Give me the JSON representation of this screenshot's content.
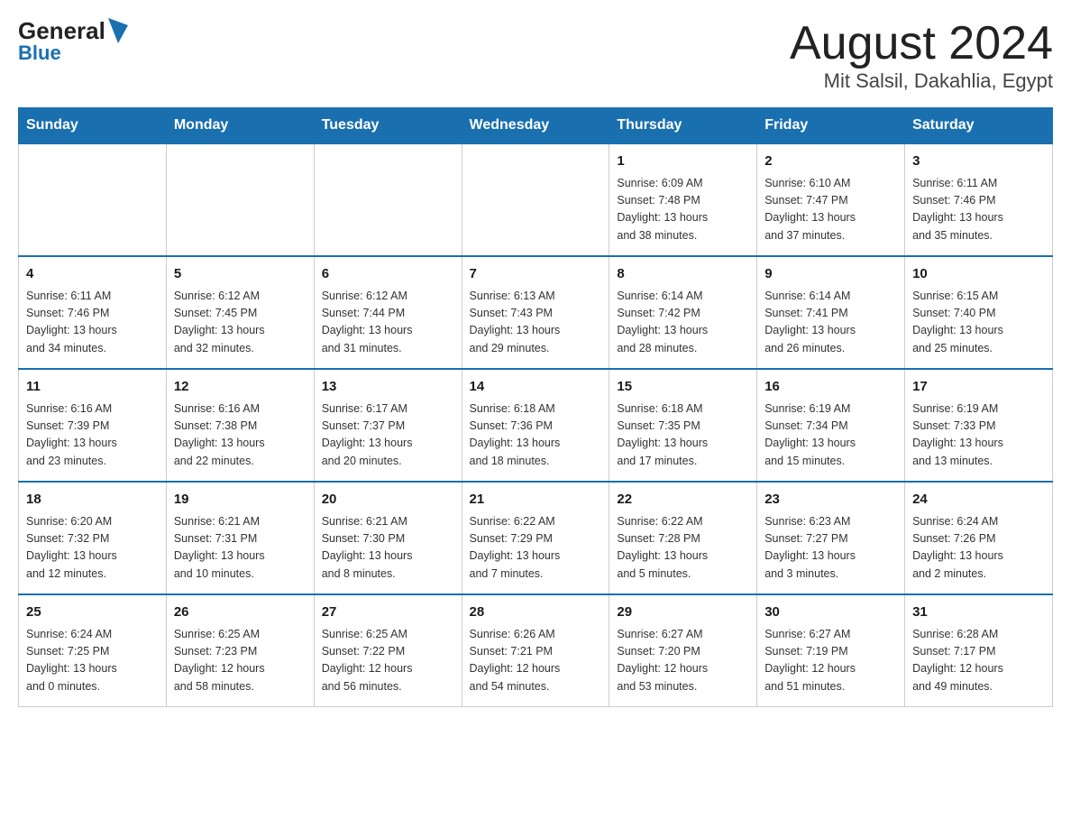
{
  "header": {
    "logo_general": "General",
    "logo_blue": "Blue",
    "title": "August 2024",
    "subtitle": "Mit Salsil, Dakahlia, Egypt"
  },
  "weekdays": [
    "Sunday",
    "Monday",
    "Tuesday",
    "Wednesday",
    "Thursday",
    "Friday",
    "Saturday"
  ],
  "weeks": [
    [
      {
        "day": "",
        "info": ""
      },
      {
        "day": "",
        "info": ""
      },
      {
        "day": "",
        "info": ""
      },
      {
        "day": "",
        "info": ""
      },
      {
        "day": "1",
        "info": "Sunrise: 6:09 AM\nSunset: 7:48 PM\nDaylight: 13 hours\nand 38 minutes."
      },
      {
        "day": "2",
        "info": "Sunrise: 6:10 AM\nSunset: 7:47 PM\nDaylight: 13 hours\nand 37 minutes."
      },
      {
        "day": "3",
        "info": "Sunrise: 6:11 AM\nSunset: 7:46 PM\nDaylight: 13 hours\nand 35 minutes."
      }
    ],
    [
      {
        "day": "4",
        "info": "Sunrise: 6:11 AM\nSunset: 7:46 PM\nDaylight: 13 hours\nand 34 minutes."
      },
      {
        "day": "5",
        "info": "Sunrise: 6:12 AM\nSunset: 7:45 PM\nDaylight: 13 hours\nand 32 minutes."
      },
      {
        "day": "6",
        "info": "Sunrise: 6:12 AM\nSunset: 7:44 PM\nDaylight: 13 hours\nand 31 minutes."
      },
      {
        "day": "7",
        "info": "Sunrise: 6:13 AM\nSunset: 7:43 PM\nDaylight: 13 hours\nand 29 minutes."
      },
      {
        "day": "8",
        "info": "Sunrise: 6:14 AM\nSunset: 7:42 PM\nDaylight: 13 hours\nand 28 minutes."
      },
      {
        "day": "9",
        "info": "Sunrise: 6:14 AM\nSunset: 7:41 PM\nDaylight: 13 hours\nand 26 minutes."
      },
      {
        "day": "10",
        "info": "Sunrise: 6:15 AM\nSunset: 7:40 PM\nDaylight: 13 hours\nand 25 minutes."
      }
    ],
    [
      {
        "day": "11",
        "info": "Sunrise: 6:16 AM\nSunset: 7:39 PM\nDaylight: 13 hours\nand 23 minutes."
      },
      {
        "day": "12",
        "info": "Sunrise: 6:16 AM\nSunset: 7:38 PM\nDaylight: 13 hours\nand 22 minutes."
      },
      {
        "day": "13",
        "info": "Sunrise: 6:17 AM\nSunset: 7:37 PM\nDaylight: 13 hours\nand 20 minutes."
      },
      {
        "day": "14",
        "info": "Sunrise: 6:18 AM\nSunset: 7:36 PM\nDaylight: 13 hours\nand 18 minutes."
      },
      {
        "day": "15",
        "info": "Sunrise: 6:18 AM\nSunset: 7:35 PM\nDaylight: 13 hours\nand 17 minutes."
      },
      {
        "day": "16",
        "info": "Sunrise: 6:19 AM\nSunset: 7:34 PM\nDaylight: 13 hours\nand 15 minutes."
      },
      {
        "day": "17",
        "info": "Sunrise: 6:19 AM\nSunset: 7:33 PM\nDaylight: 13 hours\nand 13 minutes."
      }
    ],
    [
      {
        "day": "18",
        "info": "Sunrise: 6:20 AM\nSunset: 7:32 PM\nDaylight: 13 hours\nand 12 minutes."
      },
      {
        "day": "19",
        "info": "Sunrise: 6:21 AM\nSunset: 7:31 PM\nDaylight: 13 hours\nand 10 minutes."
      },
      {
        "day": "20",
        "info": "Sunrise: 6:21 AM\nSunset: 7:30 PM\nDaylight: 13 hours\nand 8 minutes."
      },
      {
        "day": "21",
        "info": "Sunrise: 6:22 AM\nSunset: 7:29 PM\nDaylight: 13 hours\nand 7 minutes."
      },
      {
        "day": "22",
        "info": "Sunrise: 6:22 AM\nSunset: 7:28 PM\nDaylight: 13 hours\nand 5 minutes."
      },
      {
        "day": "23",
        "info": "Sunrise: 6:23 AM\nSunset: 7:27 PM\nDaylight: 13 hours\nand 3 minutes."
      },
      {
        "day": "24",
        "info": "Sunrise: 6:24 AM\nSunset: 7:26 PM\nDaylight: 13 hours\nand 2 minutes."
      }
    ],
    [
      {
        "day": "25",
        "info": "Sunrise: 6:24 AM\nSunset: 7:25 PM\nDaylight: 13 hours\nand 0 minutes."
      },
      {
        "day": "26",
        "info": "Sunrise: 6:25 AM\nSunset: 7:23 PM\nDaylight: 12 hours\nand 58 minutes."
      },
      {
        "day": "27",
        "info": "Sunrise: 6:25 AM\nSunset: 7:22 PM\nDaylight: 12 hours\nand 56 minutes."
      },
      {
        "day": "28",
        "info": "Sunrise: 6:26 AM\nSunset: 7:21 PM\nDaylight: 12 hours\nand 54 minutes."
      },
      {
        "day": "29",
        "info": "Sunrise: 6:27 AM\nSunset: 7:20 PM\nDaylight: 12 hours\nand 53 minutes."
      },
      {
        "day": "30",
        "info": "Sunrise: 6:27 AM\nSunset: 7:19 PM\nDaylight: 12 hours\nand 51 minutes."
      },
      {
        "day": "31",
        "info": "Sunrise: 6:28 AM\nSunset: 7:17 PM\nDaylight: 12 hours\nand 49 minutes."
      }
    ]
  ]
}
